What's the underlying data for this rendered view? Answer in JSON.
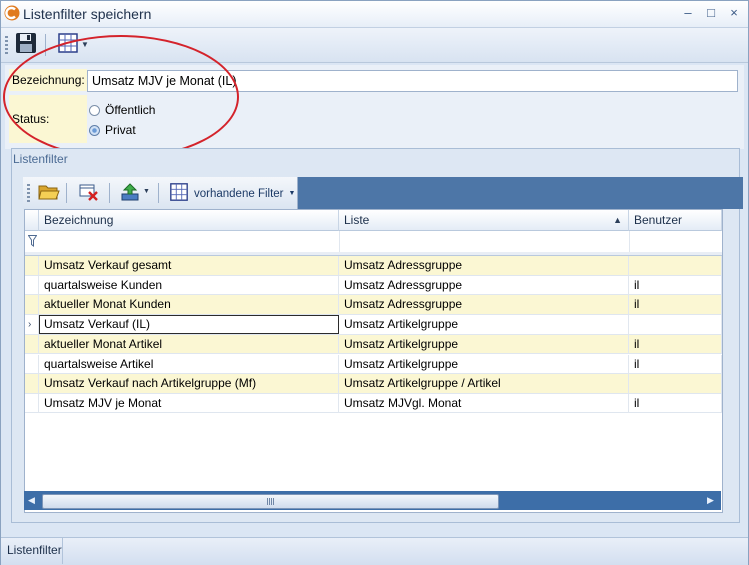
{
  "window": {
    "title": "Listenfilter speichern",
    "accent": "#e07a1f",
    "controls": {
      "minimize": "–",
      "restore": "□",
      "close": "×"
    }
  },
  "toolbar": {
    "save_icon": "floppy-disk-icon",
    "grid_icon": "grid-layout-icon"
  },
  "form": {
    "bezeichnung_label": "Bezeichnung:",
    "bezeichnung_value": "Umsatz MJV je Monat (IL)",
    "status_label": "Status:",
    "options": [
      {
        "label": "Öffentlich",
        "checked": false
      },
      {
        "label": "Privat",
        "checked": true
      }
    ]
  },
  "group": {
    "title": "Listenfilter",
    "toolbar": {
      "open_icon": "folder-open-icon",
      "delete_icon": "delete-x-icon",
      "export_icon": "export-arrow-icon",
      "filter_label": "vorhandene Filter"
    }
  },
  "grid": {
    "columns": [
      "Bezeichnung",
      "Liste",
      "Benutzer"
    ],
    "sorted_column_indicator": "▲",
    "rows": [
      {
        "bezeichnung": "Umsatz Verkauf gesamt",
        "liste": "Umsatz Adressgruppe",
        "benutzer": "",
        "alt": true
      },
      {
        "bezeichnung": "quartalsweise Kunden",
        "liste": "Umsatz Adressgruppe",
        "benutzer": "il",
        "alt": false
      },
      {
        "bezeichnung": "aktueller Monat Kunden",
        "liste": "Umsatz Adressgruppe",
        "benutzer": "il",
        "alt": true
      },
      {
        "bezeichnung": "Umsatz Verkauf (IL)",
        "liste": "Umsatz Artikelgruppe",
        "benutzer": "",
        "alt": false,
        "current": true
      },
      {
        "bezeichnung": "aktueller Monat Artikel",
        "liste": "Umsatz Artikelgruppe",
        "benutzer": "il",
        "alt": true
      },
      {
        "bezeichnung": "quartalsweise Artikel",
        "liste": "Umsatz Artikelgruppe",
        "benutzer": "il",
        "alt": false
      },
      {
        "bezeichnung": "Umsatz Verkauf nach Artikelgruppe (Mf)",
        "liste": "Umsatz Artikelgruppe / Artikel",
        "benutzer": "",
        "alt": true
      },
      {
        "bezeichnung": "Umsatz MJV je Monat",
        "liste": "Umsatz MJVgl. Monat",
        "benutzer": "il",
        "alt": false
      }
    ]
  },
  "statusbar": {
    "tab_label": "Listenfilter"
  }
}
